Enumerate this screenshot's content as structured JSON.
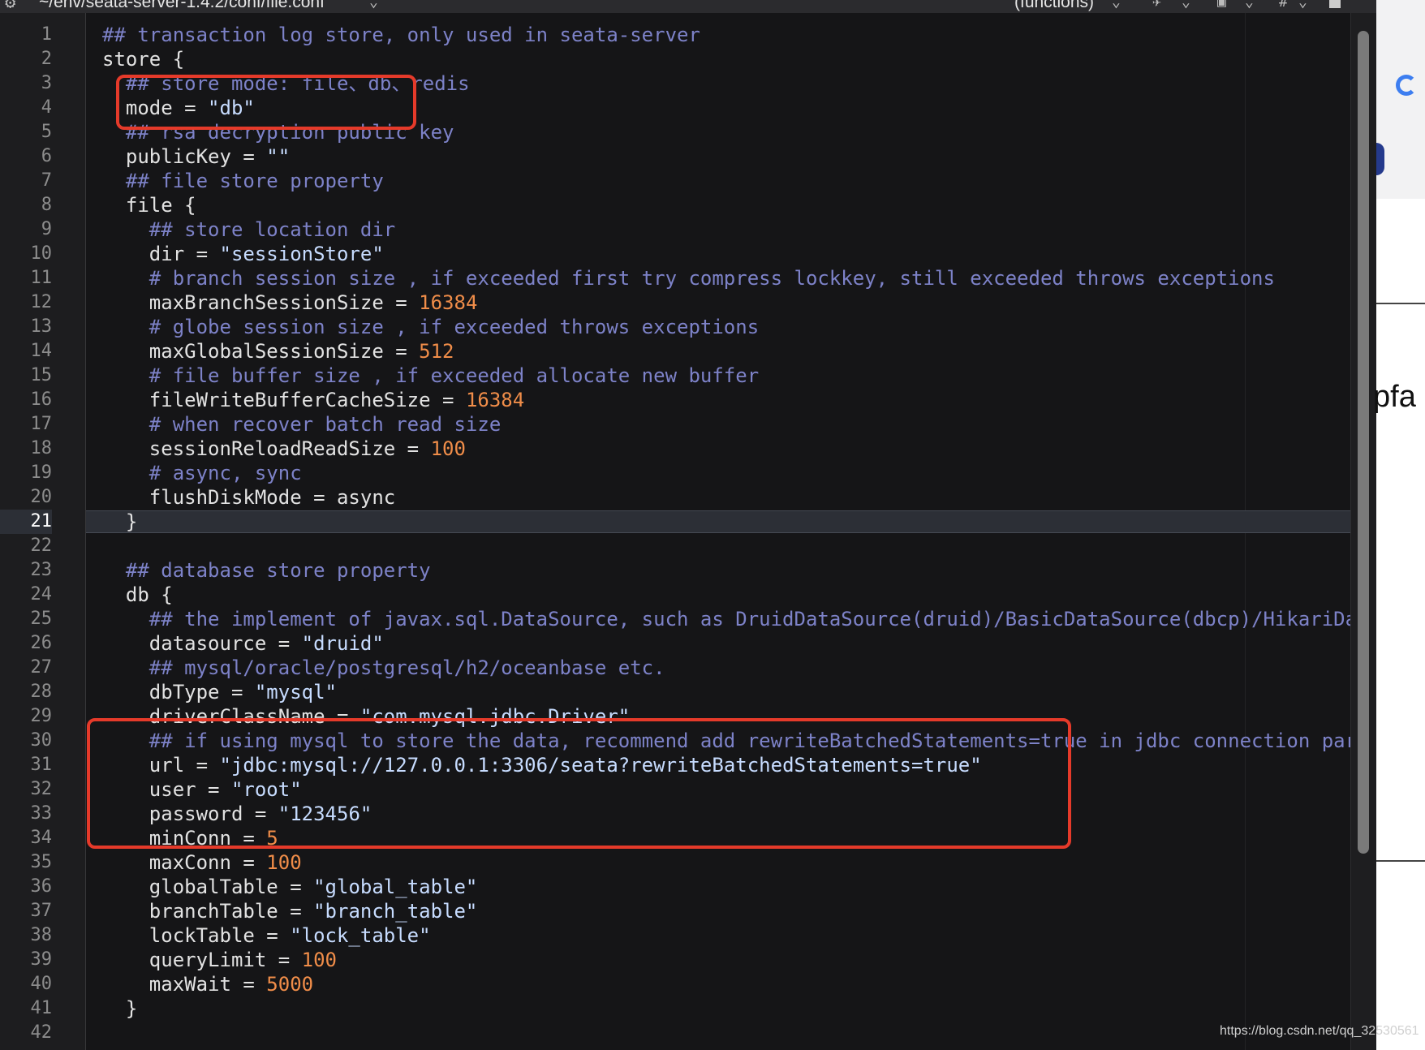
{
  "toolbar": {
    "file_path": "~/env/seata-server-1.4.2/conf/file.conf",
    "functions_menu": "(functions)",
    "hash_label": "#"
  },
  "editor": {
    "current_line": 21,
    "lines": [
      [
        {
          "t": "cm",
          "v": "## transaction log store, only used in seata-server"
        }
      ],
      [
        {
          "t": "tx",
          "v": "store {"
        }
      ],
      [
        {
          "t": "cm",
          "v": "  ## store mode: file、db、redis"
        }
      ],
      [
        {
          "t": "tx",
          "v": "  mode = "
        },
        {
          "t": "st",
          "v": "\"db\""
        }
      ],
      [
        {
          "t": "cm",
          "v": "  ## rsa decryption public key"
        }
      ],
      [
        {
          "t": "tx",
          "v": "  publicKey = "
        },
        {
          "t": "st",
          "v": "\"\""
        }
      ],
      [
        {
          "t": "cm",
          "v": "  ## file store property"
        }
      ],
      [
        {
          "t": "tx",
          "v": "  file {"
        }
      ],
      [
        {
          "t": "cm",
          "v": "    ## store location dir"
        }
      ],
      [
        {
          "t": "tx",
          "v": "    dir = "
        },
        {
          "t": "st",
          "v": "\"sessionStore\""
        }
      ],
      [
        {
          "t": "cm",
          "v": "    # branch session size , if exceeded first try compress lockkey, still exceeded throws exceptions"
        }
      ],
      [
        {
          "t": "tx",
          "v": "    maxBranchSessionSize = "
        },
        {
          "t": "nu",
          "v": "16384"
        }
      ],
      [
        {
          "t": "cm",
          "v": "    # globe session size , if exceeded throws exceptions"
        }
      ],
      [
        {
          "t": "tx",
          "v": "    maxGlobalSessionSize = "
        },
        {
          "t": "nu",
          "v": "512"
        }
      ],
      [
        {
          "t": "cm",
          "v": "    # file buffer size , if exceeded allocate new buffer"
        }
      ],
      [
        {
          "t": "tx",
          "v": "    fileWriteBufferCacheSize = "
        },
        {
          "t": "nu",
          "v": "16384"
        }
      ],
      [
        {
          "t": "cm",
          "v": "    # when recover batch read size"
        }
      ],
      [
        {
          "t": "tx",
          "v": "    sessionReloadReadSize = "
        },
        {
          "t": "nu",
          "v": "100"
        }
      ],
      [
        {
          "t": "cm",
          "v": "    # async, sync"
        }
      ],
      [
        {
          "t": "tx",
          "v": "    flushDiskMode = async"
        }
      ],
      [
        {
          "t": "tx",
          "v": "  }"
        }
      ],
      [],
      [
        {
          "t": "cm",
          "v": "  ## database store property"
        }
      ],
      [
        {
          "t": "tx",
          "v": "  db {"
        }
      ],
      [
        {
          "t": "cm",
          "v": "    ## the implement of javax.sql.DataSource, such as DruidDataSource(druid)/BasicDataSource(dbcp)/HikariDa"
        }
      ],
      [
        {
          "t": "tx",
          "v": "    datasource = "
        },
        {
          "t": "st",
          "v": "\"druid\""
        }
      ],
      [
        {
          "t": "cm",
          "v": "    ## mysql/oracle/postgresql/h2/oceanbase etc."
        }
      ],
      [
        {
          "t": "tx",
          "v": "    dbType = "
        },
        {
          "t": "st",
          "v": "\"mysql\""
        }
      ],
      [
        {
          "t": "tx",
          "v": "    driverClassName = "
        },
        {
          "t": "st",
          "v": "\"com.mysql.jdbc.Driver\""
        }
      ],
      [
        {
          "t": "cm",
          "v": "    ## if using mysql to store the data, recommend add rewriteBatchedStatements=true in jdbc connection par"
        }
      ],
      [
        {
          "t": "tx",
          "v": "    url = "
        },
        {
          "t": "st",
          "v": "\"jdbc:mysql://127.0.0.1:3306/seata?rewriteBatchedStatements=true\""
        }
      ],
      [
        {
          "t": "tx",
          "v": "    user = "
        },
        {
          "t": "st",
          "v": "\"root\""
        }
      ],
      [
        {
          "t": "tx",
          "v": "    password = "
        },
        {
          "t": "st",
          "v": "\"123456\""
        }
      ],
      [
        {
          "t": "tx",
          "v": "    minConn = "
        },
        {
          "t": "nu",
          "v": "5"
        }
      ],
      [
        {
          "t": "tx",
          "v": "    maxConn = "
        },
        {
          "t": "nu",
          "v": "100"
        }
      ],
      [
        {
          "t": "tx",
          "v": "    globalTable = "
        },
        {
          "t": "st",
          "v": "\"global_table\""
        }
      ],
      [
        {
          "t": "tx",
          "v": "    branchTable = "
        },
        {
          "t": "st",
          "v": "\"branch_table\""
        }
      ],
      [
        {
          "t": "tx",
          "v": "    lockTable = "
        },
        {
          "t": "st",
          "v": "\"lock_table\""
        }
      ],
      [
        {
          "t": "tx",
          "v": "    queryLimit = "
        },
        {
          "t": "nu",
          "v": "100"
        }
      ],
      [
        {
          "t": "tx",
          "v": "    maxWait = "
        },
        {
          "t": "nu",
          "v": "5000"
        }
      ],
      [
        {
          "t": "tx",
          "v": "  }"
        }
      ],
      []
    ]
  },
  "right_pane": {
    "partial_text": "pfa"
  },
  "watermark": "https://blog.csdn.net/qq_32530561",
  "colors": {
    "comment": "#7d82c8",
    "string": "#c7dcff",
    "number": "#f08d49",
    "highlight_box": "#e53a2a"
  }
}
